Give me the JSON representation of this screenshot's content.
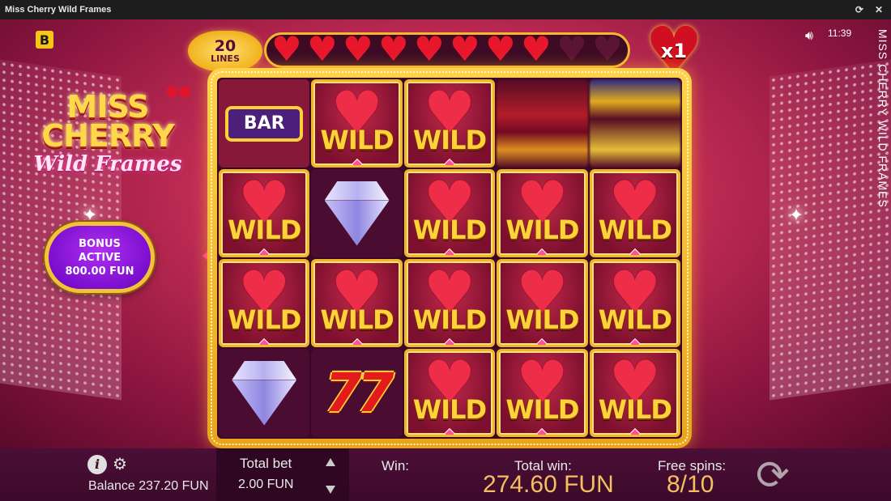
{
  "window": {
    "title": "Miss Cherry Wild Frames"
  },
  "top": {
    "lines_number": "20",
    "lines_label": "LINES",
    "hearts_filled": 8,
    "hearts_total": 10,
    "multiplier": "x1",
    "clock": "11:39",
    "vertical_title": "MISS CHERRY WILD FRAMES"
  },
  "logo": {
    "line1": "MISS",
    "line2": "CHERRY",
    "line3": "Wild Frames"
  },
  "bonus": {
    "line1": "BONUS",
    "line2": "ACTIVE",
    "line3": "800.00 FUN"
  },
  "reels": {
    "rows": [
      [
        "bar",
        "wild",
        "wild",
        "blur-red",
        "blur-blue"
      ],
      [
        "wild",
        "diamond",
        "wild",
        "wild",
        "wild"
      ],
      [
        "wild",
        "wild",
        "wild",
        "wild",
        "wild"
      ],
      [
        "diamond",
        "sevens",
        "wild",
        "wild",
        "wild"
      ]
    ],
    "wild_label": "WILD",
    "bar_label": "BAR",
    "sevens_label": "77"
  },
  "bottom": {
    "balance": "Balance 237.20 FUN",
    "total_bet_label": "Total bet",
    "total_bet_value": "2.00 FUN",
    "win_label": "Win:",
    "total_win_label": "Total win:",
    "total_win_value": "274.60 FUN",
    "free_spins_label": "Free spins:",
    "free_spins_value": "8/10"
  },
  "colors": {
    "accent_gold": "#f3c060",
    "frame_gold": "#ffd24d",
    "bonus_purple": "#7c0fd0",
    "heart_red": "#e8172c"
  },
  "icons": {
    "info": "info-icon",
    "settings": "gear-icon",
    "sound": "speaker-icon",
    "spin": "refresh-icon"
  }
}
